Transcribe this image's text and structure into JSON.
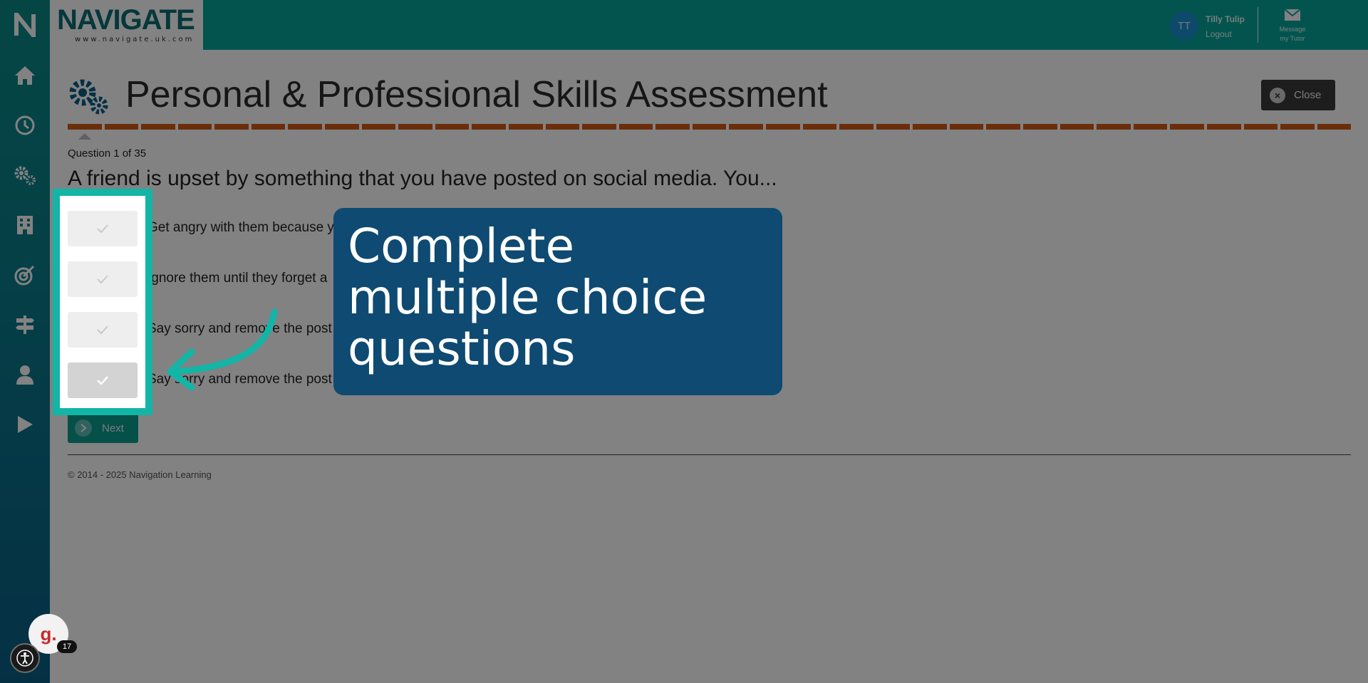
{
  "header": {
    "logo_text": "NAVIGATE",
    "logo_url": "www.navigate.uk.com",
    "user_initials": "TT",
    "user_name": "Tilly Tulip",
    "logout_label": "Logout",
    "message_label_line1": "Message",
    "message_label_line2": "my Tutor"
  },
  "sidebar": {
    "items": [
      "home-icon",
      "clock-icon",
      "cogs-icon",
      "building-icon",
      "target-icon",
      "signpost-icon",
      "user-icon",
      "play-icon"
    ]
  },
  "page": {
    "title": "Personal & Professional Skills Assessment",
    "close_label": "Close",
    "progress_segments": 35,
    "question_counter": "Question 1 of 35",
    "question": "A friend is upset by something that you have posted on social media. You...",
    "answers": [
      "Get angry with them because y",
      "Ignore them until they forget a",
      "Say sorry and remove the post",
      "Say sorry and remove the post"
    ],
    "next_label": "Next",
    "footer": "© 2014 - 2025 Navigation Learning"
  },
  "callout": {
    "text": "Complete multiple choice questions"
  },
  "widgets": {
    "g_letter": "g.",
    "g_count": "17"
  },
  "colors": {
    "header": "#06a69b",
    "sidebar_top": "#0a8a86",
    "sidebar_bottom": "#0a5f86",
    "progress": "#d15b16",
    "highlight": "#12b5a6",
    "callout": "#0e4a72"
  }
}
